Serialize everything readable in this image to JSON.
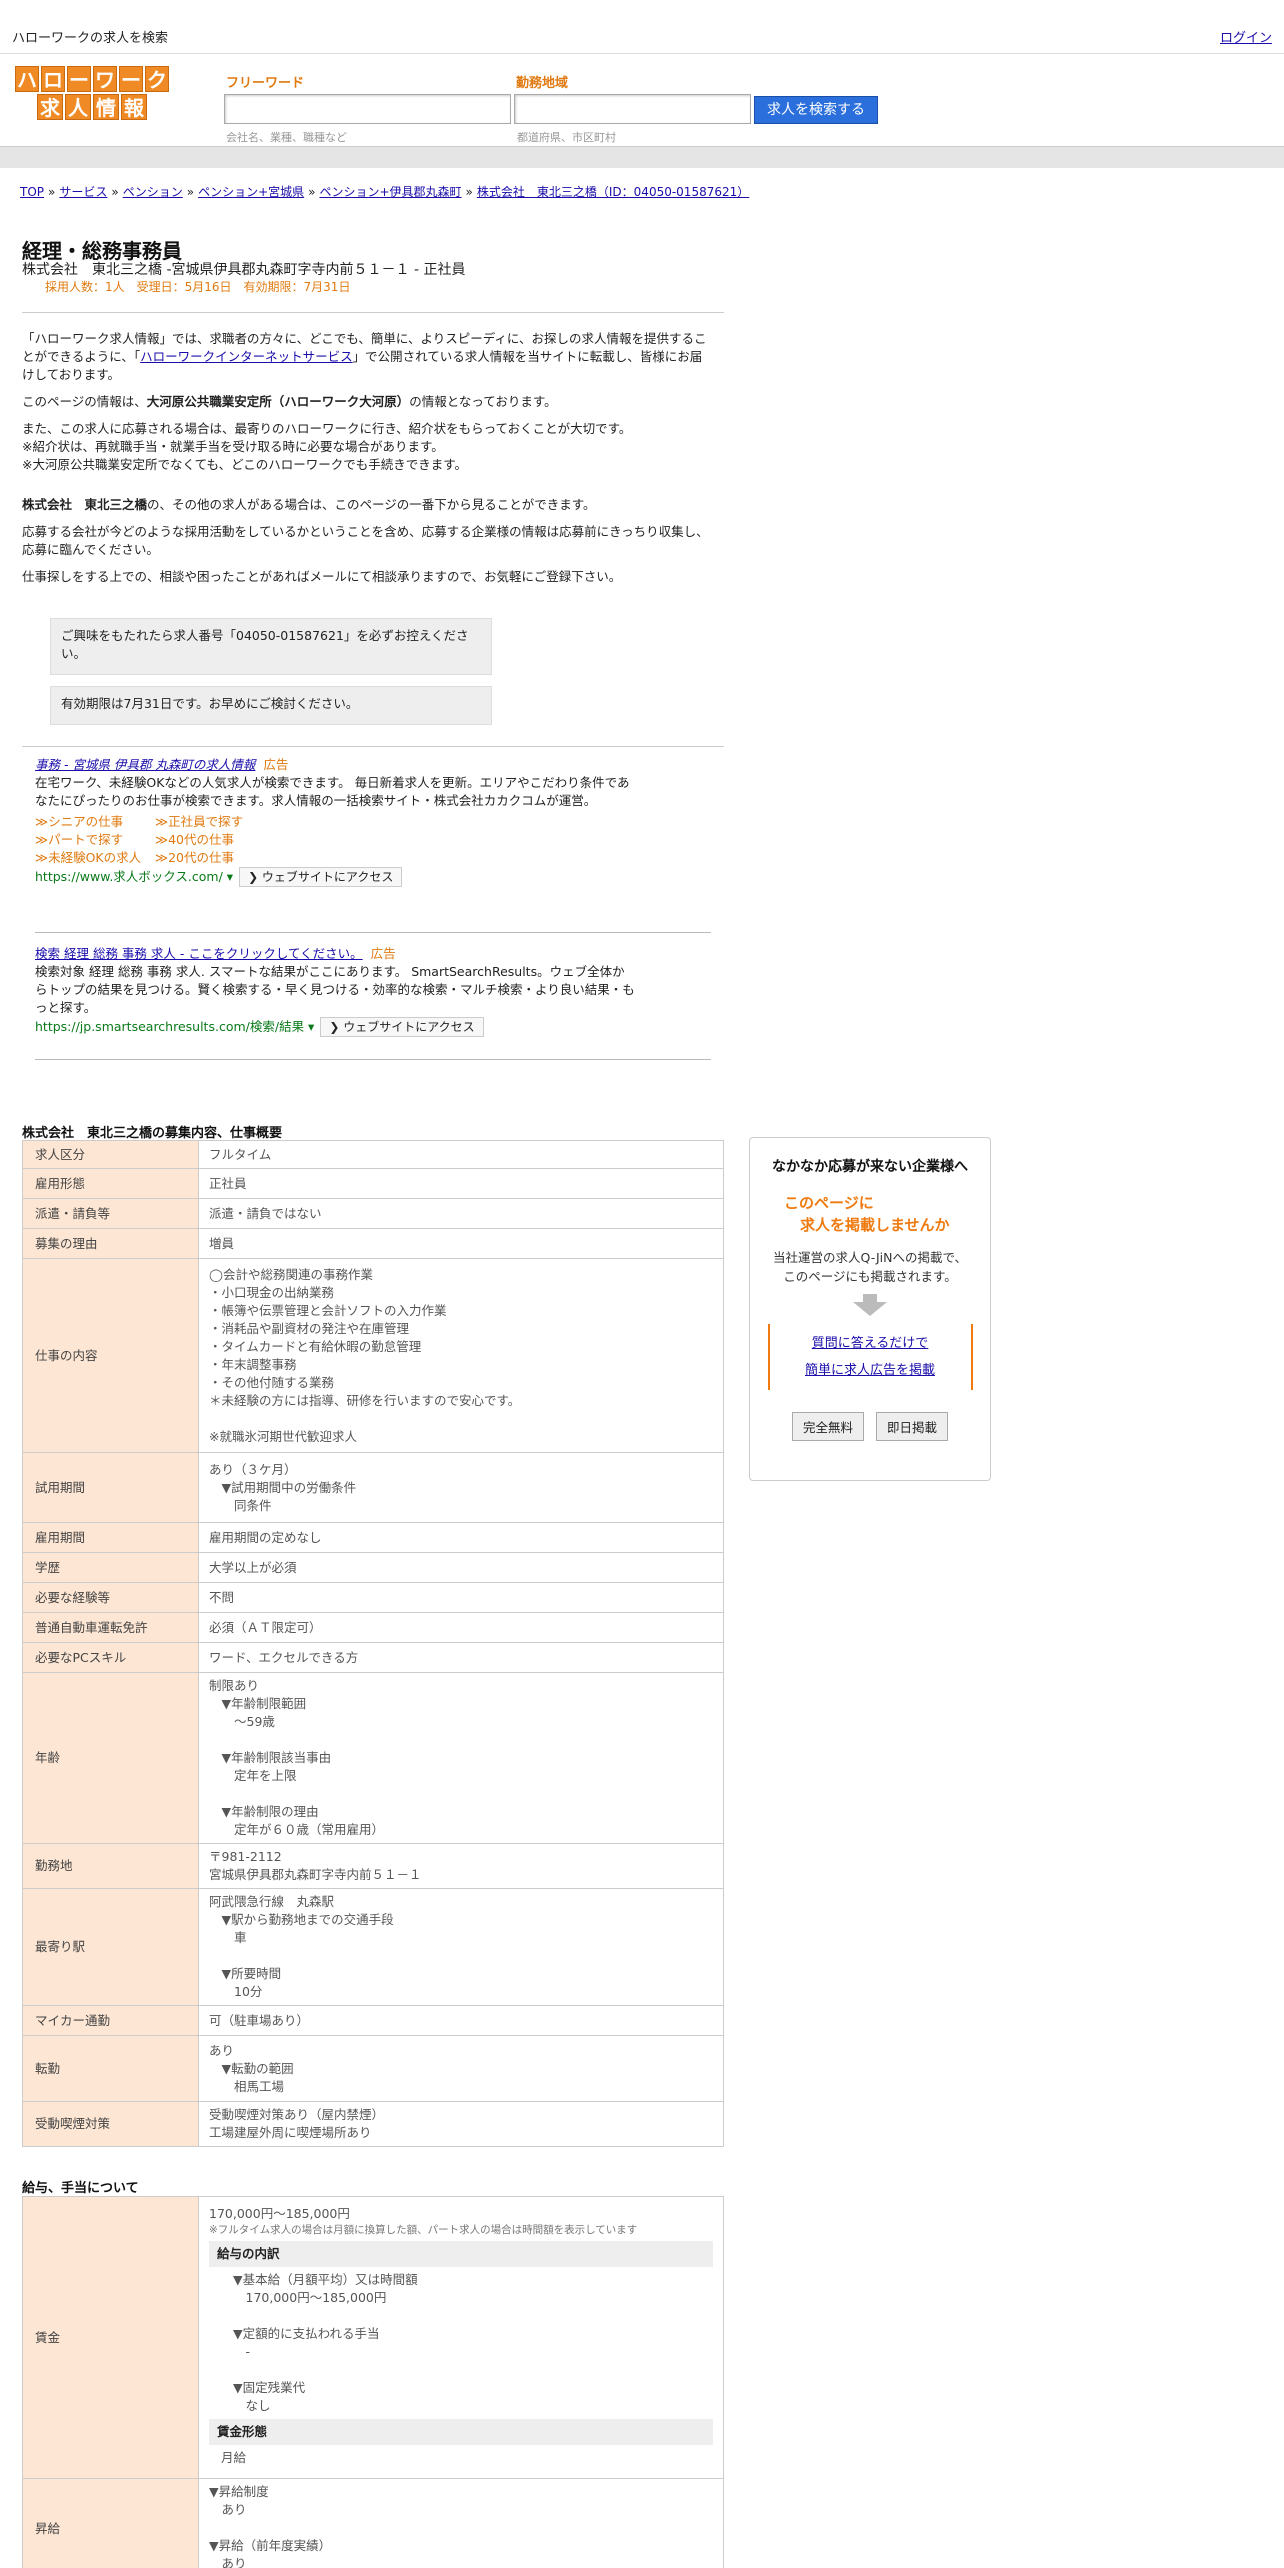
{
  "header": {
    "site_title": "ハローワークの求人を検索",
    "login": "ログイン"
  },
  "logo": {
    "row1": [
      "ハ",
      "ロ",
      "ー",
      "ワ",
      "ー",
      "ク"
    ],
    "row2": [
      "求",
      "人",
      "情",
      "報"
    ]
  },
  "search": {
    "freeword_label": "フリーワード",
    "freeword_placeholder": "会社名、業種、職種など",
    "area_label": "勤務地域",
    "area_placeholder": "都道府県、市区町村",
    "button": "求人を検索する"
  },
  "breadcrumb": [
    "TOP",
    "サービス",
    "ペンション",
    "ペンション+宮城県",
    "ペンション+伊具郡丸森町",
    "株式会社　東北三之橋（ID：04050-01587621）"
  ],
  "breadcrumb_sep": "»",
  "job": {
    "title": "経理・総務事務員",
    "company_line": "株式会社　東北三之橋 -宮城県伊具郡丸森町字寺内前５１－１ - 正社員",
    "meta": "採用人数：1人　受理日：5月16日　有効期限：7月31日"
  },
  "intro": {
    "p1_a": "「ハローワーク求人情報」では、求職者の方々に、どこでも、簡単に、よりスピーディに、お探しの求人情報を提供することができるように、「",
    "p1_link": "ハローワークインターネットサービス",
    "p1_b": "」で公開されている求人情報を当サイトに転載し、皆様にお届けしております。",
    "p2_a": "このページの情報は、",
    "p2_b": "大河原公共職業安定所（ハローワーク大河原）",
    "p2_c": "の情報となっております。",
    "p3_1": "また、この求人に応募される場合は、最寄りのハローワークに行き、紹介状をもらっておくことが大切です。",
    "p3_2": "※紹介状は、再就職手当・就業手当を受け取る時に必要な場合があります。",
    "p3_3": "※大河原公共職業安定所でなくても、どこのハローワークでも手続きできます。",
    "p4_a": "株式会社　東北三之橋",
    "p4_b": "の、その他の求人がある場合は、このページの一番下から見ることができます。",
    "p5": "応募する会社が今どのような採用活動をしているかということを含め、応募する企業様の情報は応募前にきっちり収集し、応募に臨んでください。",
    "p6": "仕事探しをする上での、相談や困ったことがあればメールにて相談承りますので、お気軽にご登録下さい。"
  },
  "notices": {
    "n1": "ご興味をもたれたら求人番号「04050-01587621」を必ずお控えください。",
    "n2": "有効期限は7月31日です。お早めにご検討ください。"
  },
  "ads": [
    {
      "title": "事務 - 宮城県 伊具郡 丸森町の求人情報",
      "badge": "広告",
      "desc": "在宅ワーク、未経験OKなどの人気求人が検索できます。 毎日新着求人を更新。エリアやこだわり条件であなたにぴったりのお仕事が検索できます。求人情報の一括検索サイト・株式会社カカクコムが運営。",
      "links": [
        [
          "≫シニアの仕事",
          "≫正社員で探す"
        ],
        [
          "≫パートで探す",
          "≫40代の仕事"
        ],
        [
          "≫未経験OKの求人",
          "≫20代の仕事"
        ]
      ],
      "url": "https://www.求人ボックス.com/",
      "visit": "❯ ウェブサイトにアクセス"
    },
    {
      "title": "検索 経理 総務 事務 求人 - ここをクリックしてください。",
      "badge": "広告",
      "desc": "検索対象 経理 総務 事務 求人. スマートな結果がここにあります。 SmartSearchResults。ウェブ全体からトップの結果を見つける。賢く検索する・早く見つける・効率的な検索・マルチ検索・より良い結果・もっと探す。",
      "url": "https://jp.smartsearchresults.com/検索/結果",
      "visit": "❯ ウェブサイトにアクセス"
    }
  ],
  "details": {
    "heading": "株式会社　東北三之橋の募集内容、仕事概要",
    "rows": [
      {
        "label": "求人区分",
        "value": "フルタイム"
      },
      {
        "label": "雇用形態",
        "value": "正社員"
      },
      {
        "label": "派遣・請負等",
        "value": "派遣・請負ではない"
      },
      {
        "label": "募集の理由",
        "value": "増員"
      },
      {
        "label": "仕事の内容",
        "lines": [
          "◯会計や総務関連の事務作業",
          "・小口現金の出納業務",
          "・帳簿や伝票管理と会計ソフトの入力作業",
          "・消耗品や副資材の発注や在庫管理",
          "・タイムカードと有給休暇の勤怠管理",
          "・年末調整事務",
          "・その他付随する業務",
          "＊未経験の方には指導、研修を行いますので安心です。",
          "",
          "※就職氷河期世代歓迎求人"
        ]
      },
      {
        "label": "試用期間",
        "lines": [
          "あり（３ケ月）",
          "　▼試用期間中の労働条件",
          "　　同条件"
        ]
      },
      {
        "label": "雇用期間",
        "value": "雇用期間の定めなし"
      },
      {
        "label": "学歴",
        "value": "大学以上が必須"
      },
      {
        "label": "必要な経験等",
        "value": "不問"
      },
      {
        "label": "普通自動車運転免許",
        "value": "必須（ＡＴ限定可）"
      },
      {
        "label": "必要なPCスキル",
        "value": "ワード、エクセルできる方"
      },
      {
        "label": "年齢",
        "lines": [
          "制限あり",
          "　▼年齢制限範囲",
          "　　〜59歳",
          "",
          "　▼年齢制限該当事由",
          "　　定年を上限",
          "",
          "　▼年齢制限の理由",
          "　　定年が６０歳（常用雇用）"
        ]
      },
      {
        "label": "勤務地",
        "lines": [
          "〒981-2112",
          "宮城県伊具郡丸森町字寺内前５１－１"
        ]
      },
      {
        "label": "最寄り駅",
        "lines": [
          "阿武隈急行線　丸森駅",
          "　▼駅から勤務地までの交通手段",
          "　　車",
          "",
          "　▼所要時間",
          "　　10分"
        ]
      },
      {
        "label": "マイカー通勤",
        "value": "可（駐車場あり）"
      },
      {
        "label": "転勤",
        "lines": [
          "あり",
          "　▼転勤の範囲",
          "　　相馬工場"
        ]
      },
      {
        "label": "受動喫煙対策",
        "lines": [
          "受動喫煙対策あり（屋内禁煙）",
          "工場建屋外周に喫煙場所あり"
        ]
      }
    ]
  },
  "salary": {
    "heading": "給与、手当について",
    "wage_label": "賃金",
    "wage_range": "170,000円〜185,000円",
    "wage_note": "※フルタイム求人の場合は月額に換算した額、パート求人の場合は時間額を表示しています",
    "breakdown_title": "給与の内訳",
    "breakdown": [
      "▼基本給（月額平均）又は時間額",
      "　170,000円〜185,000円",
      "",
      "▼定額的に支払われる手当",
      "　-",
      "",
      "▼固定残業代",
      "　なし"
    ],
    "form_title": "賃金形態",
    "form_value": "月給",
    "raise_label": "昇給",
    "raise_lines": [
      "▼昇給制度",
      "　あり",
      "",
      "▼昇給（前年度実績）",
      "　あり"
    ]
  },
  "side_ad": {
    "title": "なかなか応募が来ない企業様へ",
    "orange_1": "このページに",
    "orange_2": "求人を掲載しませんか",
    "text_1": "当社運営の求人Q-JiNへの掲載で、",
    "text_2": "このページにも掲載されます。",
    "link_1": "質問に答えるだけで",
    "link_2": "簡単に求人広告を掲載",
    "btn_1": "完全無料",
    "btn_2": "即日掲載"
  },
  "colors": {
    "brand_orange": "#f08a24",
    "accent_orange": "#e07a10",
    "label_bg": "#fde6d4",
    "search_blue": "#2a6fdb",
    "link": "#1a0dab",
    "ad_url_green": "#0a7a1a"
  }
}
